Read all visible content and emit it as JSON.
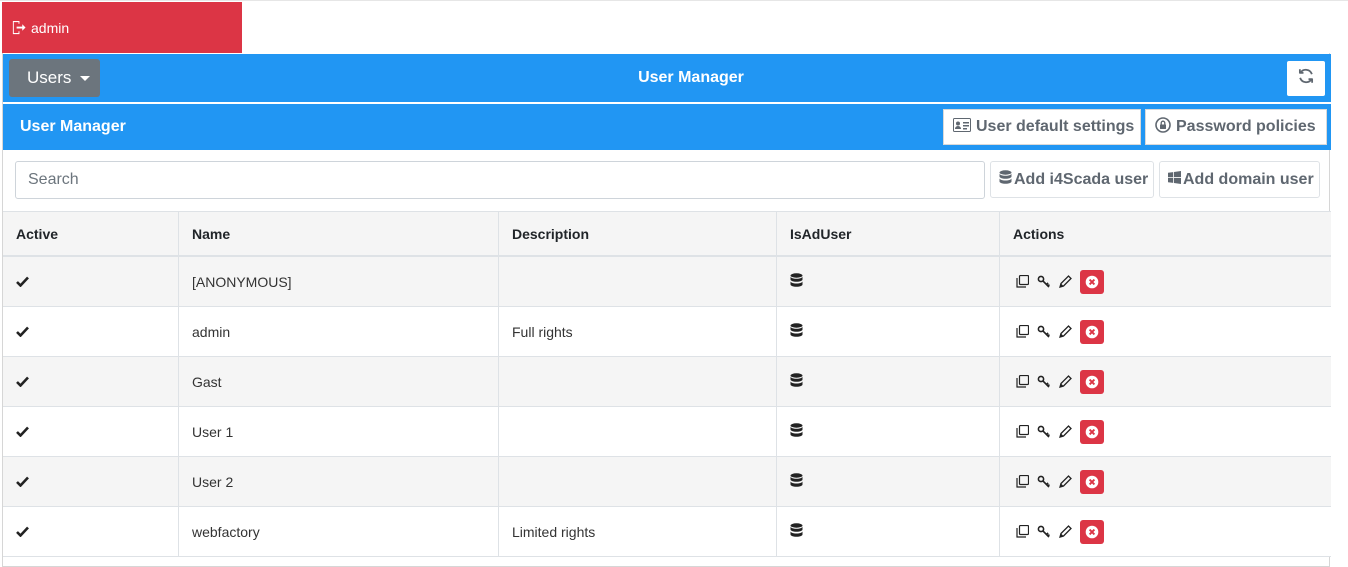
{
  "logout": {
    "label": "admin",
    "icon": "sign-out-icon",
    "color": "#dc3545"
  },
  "header": {
    "dropdown_label": "Users",
    "title": "User Manager",
    "refresh_icon": "refresh-icon",
    "accent": "#2196f3"
  },
  "subheader": {
    "title": "User Manager",
    "defaults_label": "User default settings",
    "policies_label": "Password policies"
  },
  "toolbar": {
    "search_placeholder": "Search",
    "add_i4scada_label": "Add i4Scada user",
    "add_domain_label": "Add domain user"
  },
  "table": {
    "columns": [
      "Active",
      "Name",
      "Description",
      "IsAdUser",
      "Actions"
    ],
    "rows": [
      {
        "active": true,
        "name": "[ANONYMOUS]",
        "description": ""
      },
      {
        "active": true,
        "name": "admin",
        "description": "Full rights"
      },
      {
        "active": true,
        "name": "Gast",
        "description": ""
      },
      {
        "active": true,
        "name": "User 1",
        "description": ""
      },
      {
        "active": true,
        "name": "User 2",
        "description": ""
      },
      {
        "active": true,
        "name": "webfactory",
        "description": "Limited rights"
      }
    ],
    "isaduser_icon": "database-icon",
    "action_icons": [
      "copy-icon",
      "key-icon",
      "pencil-icon",
      "delete-icon"
    ],
    "delete_color": "#dc3545"
  }
}
